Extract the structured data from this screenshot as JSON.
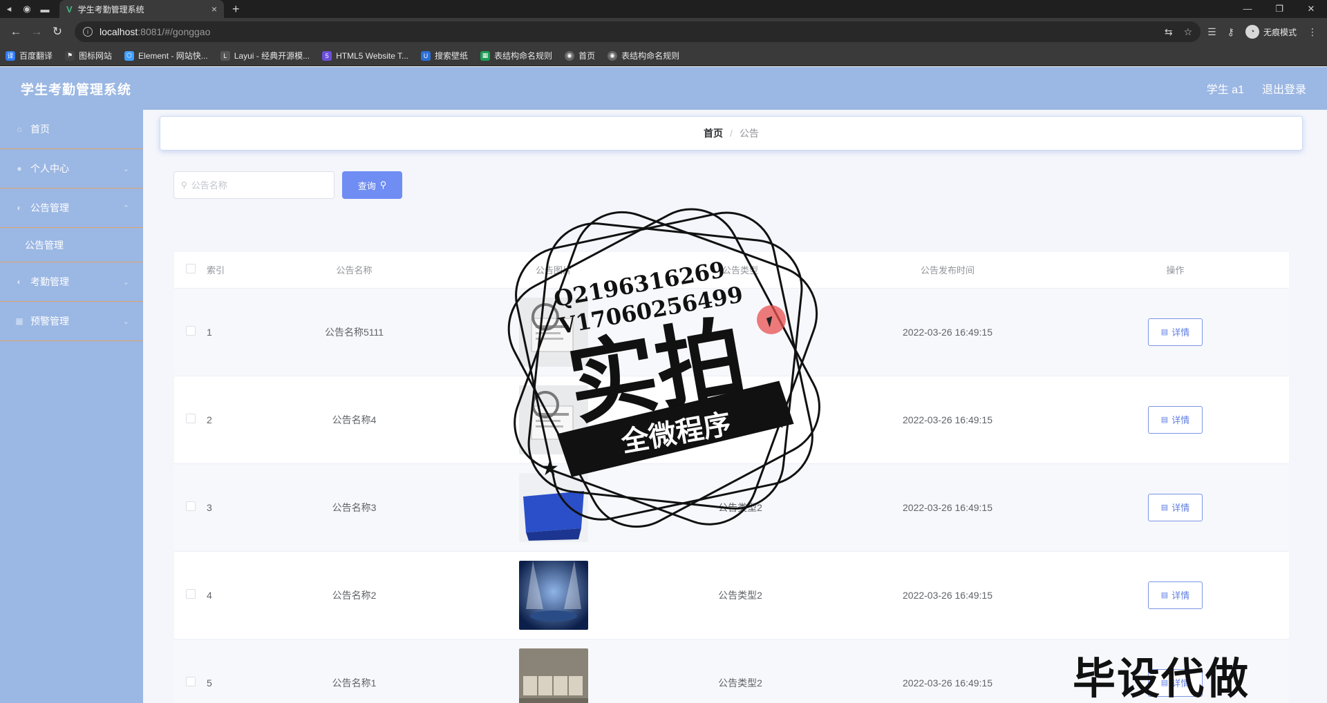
{
  "browser": {
    "tab_title": "学生考勤管理系统",
    "url_host": "localhost",
    "url_path": ":8081/#/gonggao",
    "incognito_label": "无痕模式",
    "bookmarks": [
      {
        "label": "百度翻译",
        "color": "#2f7cf6"
      },
      {
        "label": "图标网站",
        "color": "#444444"
      },
      {
        "label": "Element - 网站快...",
        "color": "#409eff"
      },
      {
        "label": "Layui - 经典开源模...",
        "color": "#555555"
      },
      {
        "label": "HTML5 Website T...",
        "color": "#6b4fd8"
      },
      {
        "label": "搜索壁纸",
        "color": "#2b6fd6"
      },
      {
        "label": "表结构命名规则",
        "color": "#1e9d55"
      },
      {
        "label": "首页",
        "color": "#666666"
      },
      {
        "label": "表结构命名规则",
        "color": "#666666"
      }
    ]
  },
  "header": {
    "title": "学生考勤管理系统",
    "user": "学生 a1",
    "logout": "退出登录"
  },
  "sidebar": {
    "items": [
      {
        "label": "首页",
        "icon": "home-icon",
        "glyph": "⌂",
        "chevron": false
      },
      {
        "label": "个人中心",
        "icon": "user-icon",
        "glyph": "●",
        "chevron": true
      },
      {
        "label": "公告管理",
        "icon": "notice-icon",
        "glyph": "◐",
        "chevron": true
      }
    ],
    "sub_item": "公告管理",
    "items_after": [
      {
        "label": "考勤管理",
        "icon": "attendance-icon",
        "glyph": "◐",
        "chevron": true
      },
      {
        "label": "预警管理",
        "icon": "warning-icon",
        "glyph": "▦",
        "chevron": true
      }
    ]
  },
  "breadcrumb": {
    "home": "首页",
    "separator": "/",
    "current": "公告"
  },
  "search": {
    "placeholder": "公告名称",
    "button": "查询"
  },
  "table": {
    "columns": [
      "索引",
      "公告名称",
      "公告图片",
      "公告类型",
      "公告发布时间",
      "操作"
    ],
    "rows": [
      {
        "index": "1",
        "name": "公告名称5111",
        "image": "news-paper",
        "type": "",
        "time": "2022-03-26 16:49:15",
        "action": "详情"
      },
      {
        "index": "2",
        "name": "公告名称4",
        "image": "news-paper",
        "type": "",
        "time": "2022-03-26 16:49:15",
        "action": "详情"
      },
      {
        "index": "3",
        "name": "公告名称3",
        "image": "news-blue",
        "type": "公告类型2",
        "time": "2022-03-26 16:49:15",
        "action": "详情"
      },
      {
        "index": "4",
        "name": "公告名称2",
        "image": "news-stage",
        "type": "公告类型2",
        "time": "2022-03-26 16:49:15",
        "action": "详情"
      },
      {
        "index": "5",
        "name": "公告名称1",
        "image": "news-blocks",
        "type": "公告类型2",
        "time": "2022-03-26 16:49:15",
        "action": "详情"
      }
    ]
  },
  "overlay": {
    "stamp_qq": "Q2196316269",
    "stamp_wx": "V17060256499",
    "stamp_main": "实拍",
    "stamp_banner": "全微程序",
    "watermark": "毕设代做"
  },
  "colors": {
    "sidebar_bg": "#9bb7e3",
    "accent": "#6f8df2",
    "divider": "#e0a36a"
  }
}
